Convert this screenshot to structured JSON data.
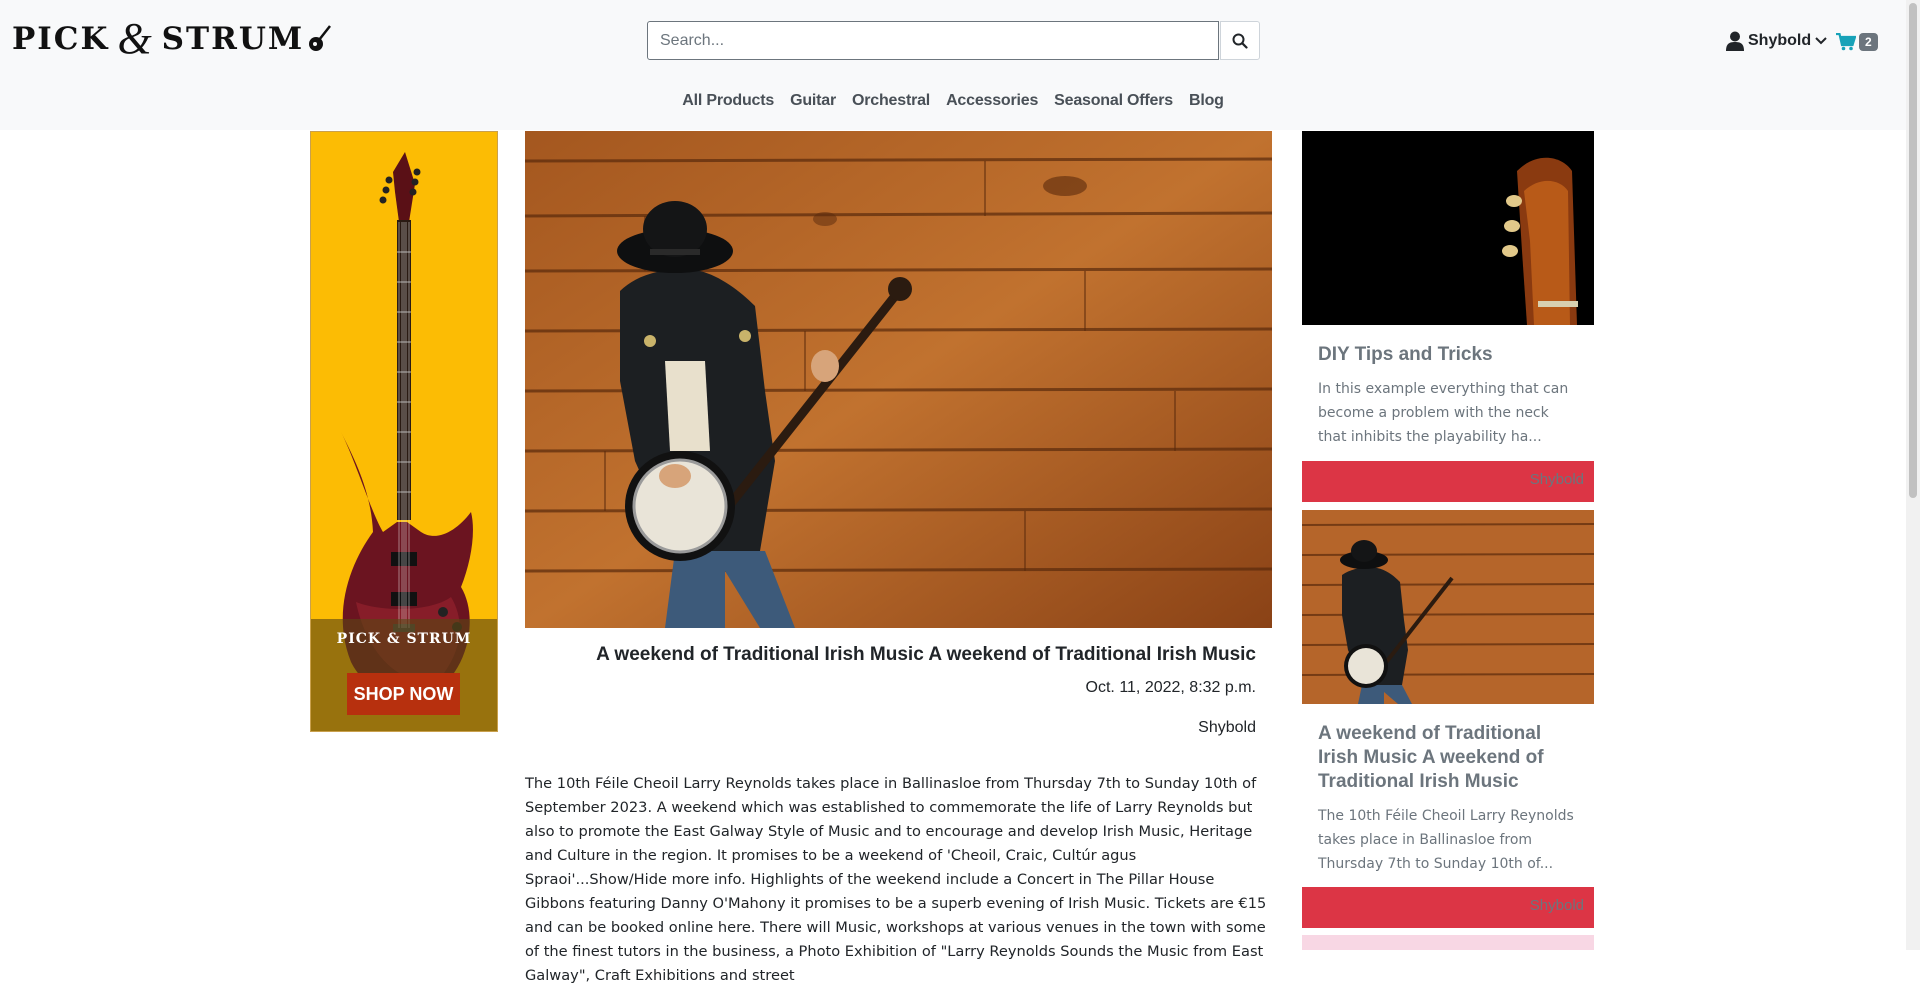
{
  "header": {
    "logo_text_left": "PICK",
    "logo_amp": "&",
    "logo_text_right": "STRUM",
    "search_placeholder": "Search...",
    "account_name": "Shybold",
    "cart_count": "2"
  },
  "nav": {
    "items": [
      "All Products",
      "Guitar",
      "Orchestral",
      "Accessories",
      "Seasonal Offers",
      "Blog"
    ]
  },
  "ad": {
    "logo_text": "PICK & STRUM",
    "button_label": "SHOP NOW"
  },
  "article": {
    "title": "A weekend of Traditional Irish Music A weekend of Traditional Irish Music",
    "date": "Oct. 11, 2022, 8:32 p.m.",
    "author": "Shybold",
    "body": "The 10th Féile Cheoil Larry Reynolds takes place in Ballinasloe from Thursday 7th to Sunday 10th of September 2023. A weekend which was established to commemorate the life of Larry Reynolds but also to promote the East Galway Style of Music and to encourage and develop Irish Music, Heritage and Culture in the region. It promises to be a weekend of 'Cheoil, Craic, Cultúr agus Spraoi'...Show/Hide more info. Highlights of the weekend include a Concert in The Pillar House Gibbons featuring Danny O'Mahony it promises to be a superb evening of Irish Music. Tickets are €15 and can be booked online here. There will Music, workshops at various venues in the town with some of the finest tutors in the business, a Photo Exhibition of \"Larry Reynolds Sounds the Music from East Galway\", Craft Exhibitions and street"
  },
  "sidebar": {
    "cards": [
      {
        "title": "DIY Tips and Tricks",
        "text": "In this example everything that can become a problem with the neck that inhibits the playability ha...",
        "author": "Shybold"
      },
      {
        "title": "A weekend of Traditional Irish Music A weekend of Traditional Irish Music",
        "text": "The 10th Féile Cheoil Larry Reynolds takes place in Ballinasloe from Thursday 7th to Sunday 10th of...",
        "author": "Shybold"
      }
    ]
  },
  "colors": {
    "header_bg": "#f8f9fa",
    "ad_yellow": "#fcbc04",
    "card_footer_red": "#dc3545",
    "cart_icon": "#17a2b8"
  }
}
